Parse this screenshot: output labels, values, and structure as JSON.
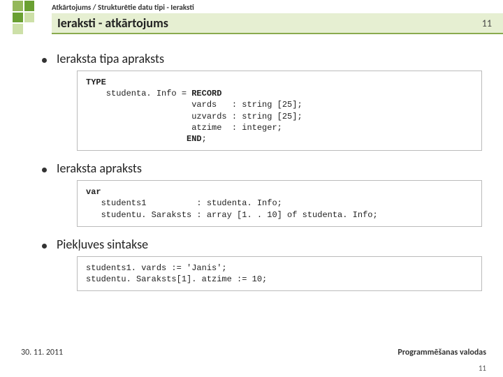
{
  "breadcrumb": "Atkārtojums / Strukturētie datu tipi - Ieraksti",
  "title": "Ieraksti - atkārtojums",
  "slide_number_header": "11",
  "bullets": {
    "b1": "Ieraksta tipa apraksts",
    "b2": "Ieraksta apraksts",
    "b3": "Piekļuves sintakse"
  },
  "code": {
    "c1_l1a": "TYPE",
    "c1_l2a": "    studenta. Info = ",
    "c1_l2b": "RECORD",
    "c1_l3": "                     vards   : string [25];",
    "c1_l4": "                     uzvards : string [25];",
    "c1_l5": "                     atzime  : integer;",
    "c1_l6a": "                    ",
    "c1_l6b": "END",
    "c1_l6c": ";",
    "c2_l1a": "var",
    "c2_l2": "   students1          : studenta. Info;",
    "c2_l3": "   studentu. Saraksts : array [1. . 10] of studenta. Info;",
    "c3_l1": "students1. vards := 'Janis';",
    "c3_l2": "studentu. Saraksts[1]. atzime := 10;"
  },
  "footer": {
    "date": "30. 11. 2011",
    "course": "Programmēšanas valodas",
    "page": "11"
  }
}
